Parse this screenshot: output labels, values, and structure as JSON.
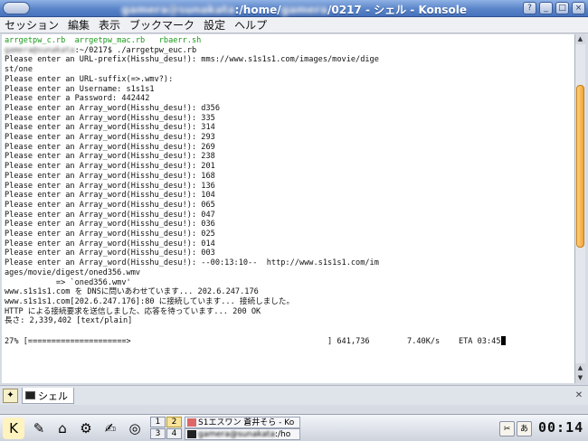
{
  "window": {
    "title_user": "gamera@sunakata",
    "title_path": ":/home/",
    "title_user2": "gamera",
    "title_rest": "/0217 - シェル - Konsole"
  },
  "menu": [
    "セッション",
    "編集",
    "表示",
    "ブックマーク",
    "設定",
    "ヘルプ"
  ],
  "terminal": {
    "files_line": "arrgetpw_c.rb  arrgetpw_mac.rb   rbaerr.sh",
    "prompt_user": "gamera@sunakata",
    "prompt_cmd": ":~/0217$ ./arrgetpw_euc.rb",
    "lines": [
      "Please enter an URL-prefix(Hisshu_desu!): mms://www.s1s1s1.com/images/movie/dige",
      "st/one",
      "Please enter an URL-suffix(=>.wmv?):",
      "Please enter an Username: s1s1s1",
      "Please enter a Password: 442442",
      "Please enter an Array_word(Hisshu_desu!): d356",
      "Please enter an Array_word(Hisshu_desu!): 335",
      "Please enter an Array_word(Hisshu_desu!): 314",
      "Please enter an Array_word(Hisshu_desu!): 293",
      "Please enter an Array_word(Hisshu_desu!): 269",
      "Please enter an Array_word(Hisshu_desu!): 238",
      "Please enter an Array_word(Hisshu_desu!): 201",
      "Please enter an Array_word(Hisshu_desu!): 168",
      "Please enter an Array_word(Hisshu_desu!): 136",
      "Please enter an Array_word(Hisshu_desu!): 104",
      "Please enter an Array_word(Hisshu_desu!): 065",
      "Please enter an Array_word(Hisshu_desu!): 047",
      "Please enter an Array_word(Hisshu_desu!): 036",
      "Please enter an Array_word(Hisshu_desu!): 025",
      "Please enter an Array_word(Hisshu_desu!): 014",
      "Please enter an Array_word(Hisshu_desu!): 003",
      "Please enter an Array_word(Hisshu_desu!): --00:13:10--  http://www.s1s1s1.com/im",
      "ages/movie/digest/oned356.wmv",
      "           => `oned356.wmv'",
      "www.s1s1s1.com を DNSに問いあわせています... 202.6.247.176",
      "www.s1s1s1.com[202.6.247.176]:80 に接続しています... 接続しました。",
      "HTTP による接続要求を送信しました、応答を待っています... 200 OK",
      "長さ: 2,339,402 [text/plain]"
    ],
    "progress_pct": "27%",
    "progress_bar": "[=====================>",
    "progress_end": "] 641,736",
    "speed": "7.40K/s",
    "eta": "ETA 03:45"
  },
  "tabs": {
    "session_label": "シェル"
  },
  "taskbar": {
    "pager": [
      "1",
      "2",
      "3",
      "4"
    ],
    "active_desktop": "2",
    "task1": "S1エスワン 蒼井そら - Ko",
    "task2_user": "gamera@sunakata",
    "task2_rest": ":/ho",
    "clock": "00:14"
  }
}
